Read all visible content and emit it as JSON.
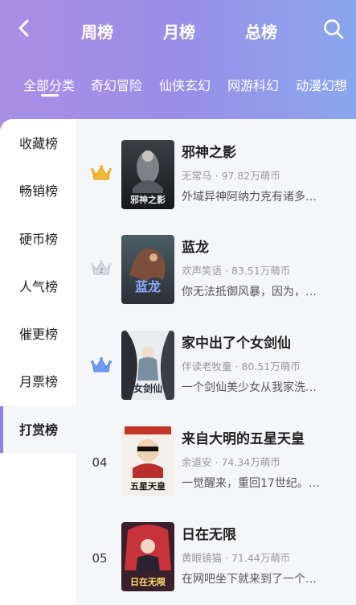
{
  "header": {
    "tabs": [
      "周榜",
      "月榜",
      "总榜"
    ],
    "active_tab": "总榜"
  },
  "categories": [
    "全部分类",
    "奇幻冒险",
    "仙侠玄幻",
    "网游科幻",
    "动漫幻想"
  ],
  "active_category": "全部分类",
  "sidebar": {
    "items": [
      "收藏榜",
      "畅销榜",
      "硬币榜",
      "人气榜",
      "催更榜",
      "月票榜",
      "打赏榜"
    ],
    "active": "打赏榜"
  },
  "books": [
    {
      "rank": "1",
      "rank_style": "gold-crown",
      "title": "邪神之影",
      "author": "无常马",
      "coins": "97.82万萌币",
      "desc": "外域异神阿纳力克有诸多…",
      "cover_text": "邪神之影"
    },
    {
      "rank": "2",
      "rank_style": "silver-crown",
      "title": "蓝龙",
      "author": "欢声笑语",
      "coins": "83.51万萌币",
      "desc": "你无法抵御风暴，因为，…",
      "cover_text": "蓝龙"
    },
    {
      "rank": "3",
      "rank_style": "blue-crown",
      "title": "家中出了个女剑仙",
      "author": "伴读老牧童",
      "coins": "80.51万萌币",
      "desc": "一个剑仙美少女从我家洗…",
      "cover_text": "女剑仙"
    },
    {
      "rank": "04",
      "rank_style": "number",
      "title": "来自大明的五星天皇",
      "author": "余道安",
      "coins": "74.34万萌币",
      "desc": "一觉醒来，重回17世纪。…",
      "cover_text": "五星天皇"
    },
    {
      "rank": "05",
      "rank_style": "number",
      "title": "日在无限",
      "author": "黄眼镜猫",
      "coins": "71.44万萌币",
      "desc": "在网吧坐下就来到了一个…",
      "cover_text": "日在无限"
    }
  ],
  "meta_separator": "·",
  "colors": {
    "header_gradient_start": "#a98ee6",
    "header_gradient_end": "#8aa6ee",
    "accent": "#8f7fe8",
    "gold": "#f3b733",
    "silver": "#c9cdd8",
    "blue": "#5f8ff0"
  }
}
